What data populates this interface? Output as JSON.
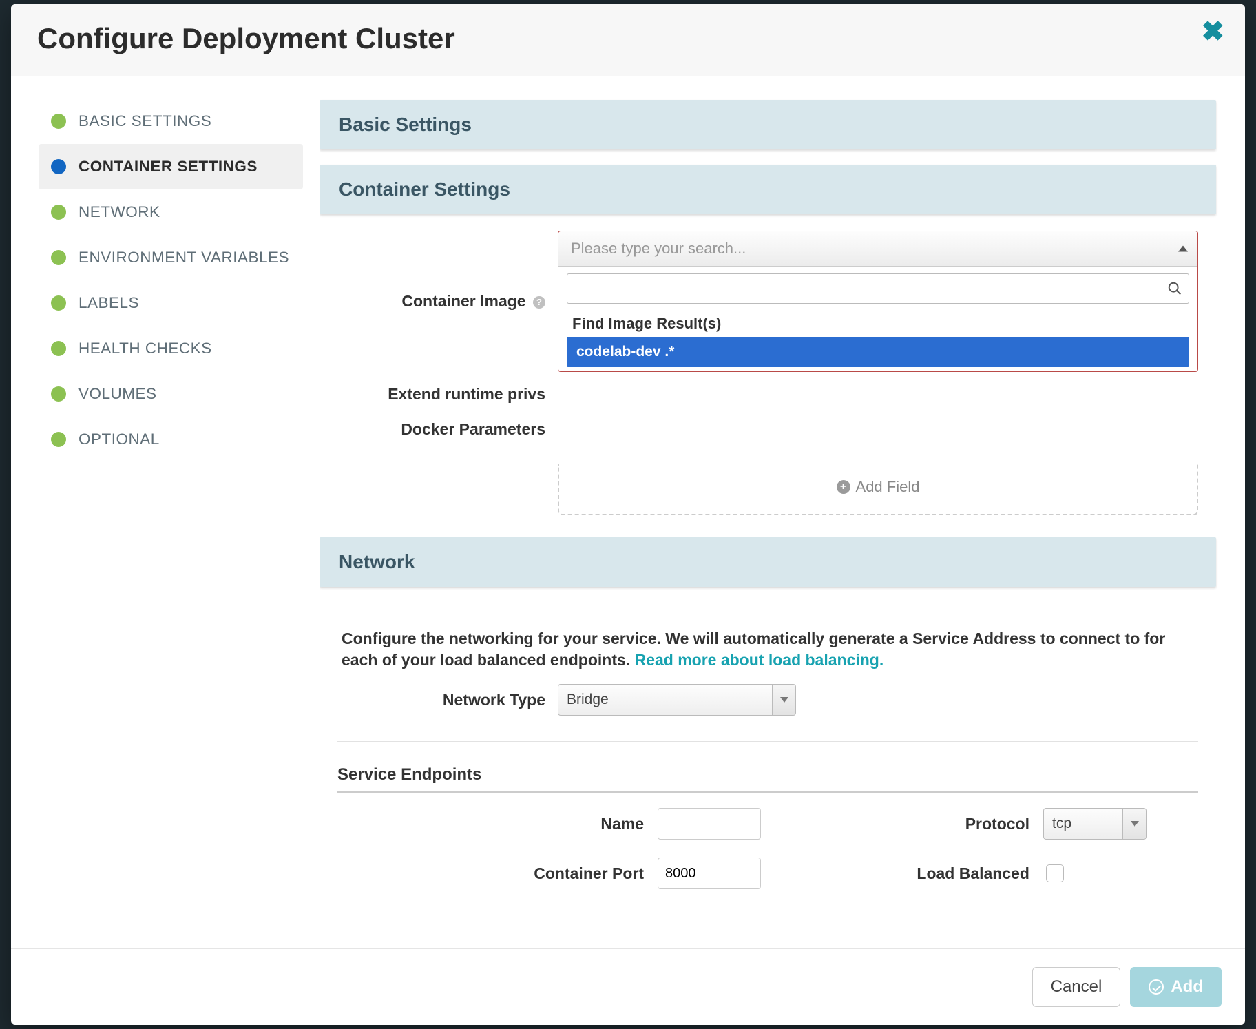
{
  "header": {
    "title": "Configure Deployment Cluster"
  },
  "sidebar": {
    "items": [
      {
        "label": "BASIC SETTINGS"
      },
      {
        "label": "CONTAINER SETTINGS"
      },
      {
        "label": "NETWORK"
      },
      {
        "label": "ENVIRONMENT VARIABLES"
      },
      {
        "label": "LABELS"
      },
      {
        "label": "HEALTH CHECKS"
      },
      {
        "label": "VOLUMES"
      },
      {
        "label": "OPTIONAL"
      }
    ]
  },
  "sections": {
    "basic": {
      "title": "Basic Settings"
    },
    "container": {
      "title": "Container Settings",
      "image_label": "Container Image",
      "extend_label": "Extend runtime privs",
      "docker_label": "Docker Parameters",
      "image_placeholder": "Please type your search...",
      "drop_group": "Find Image Result(s)",
      "drop_option": "codelab-dev .*",
      "add_field": "Add Field"
    },
    "network": {
      "title": "Network",
      "desc_main": "Configure the networking for your service. We will automatically generate a Service Address to connect to for each of your load balanced endpoints. ",
      "desc_link": "Read more about load balancing.",
      "type_label": "Network Type",
      "type_value": "Bridge",
      "endpoints_title": "Service Endpoints",
      "name_label": "Name",
      "port_label": "Container Port",
      "port_value": "8000",
      "protocol_label": "Protocol",
      "protocol_value": "tcp",
      "lb_label": "Load Balanced"
    }
  },
  "footer": {
    "cancel": "Cancel",
    "add": "Add"
  }
}
